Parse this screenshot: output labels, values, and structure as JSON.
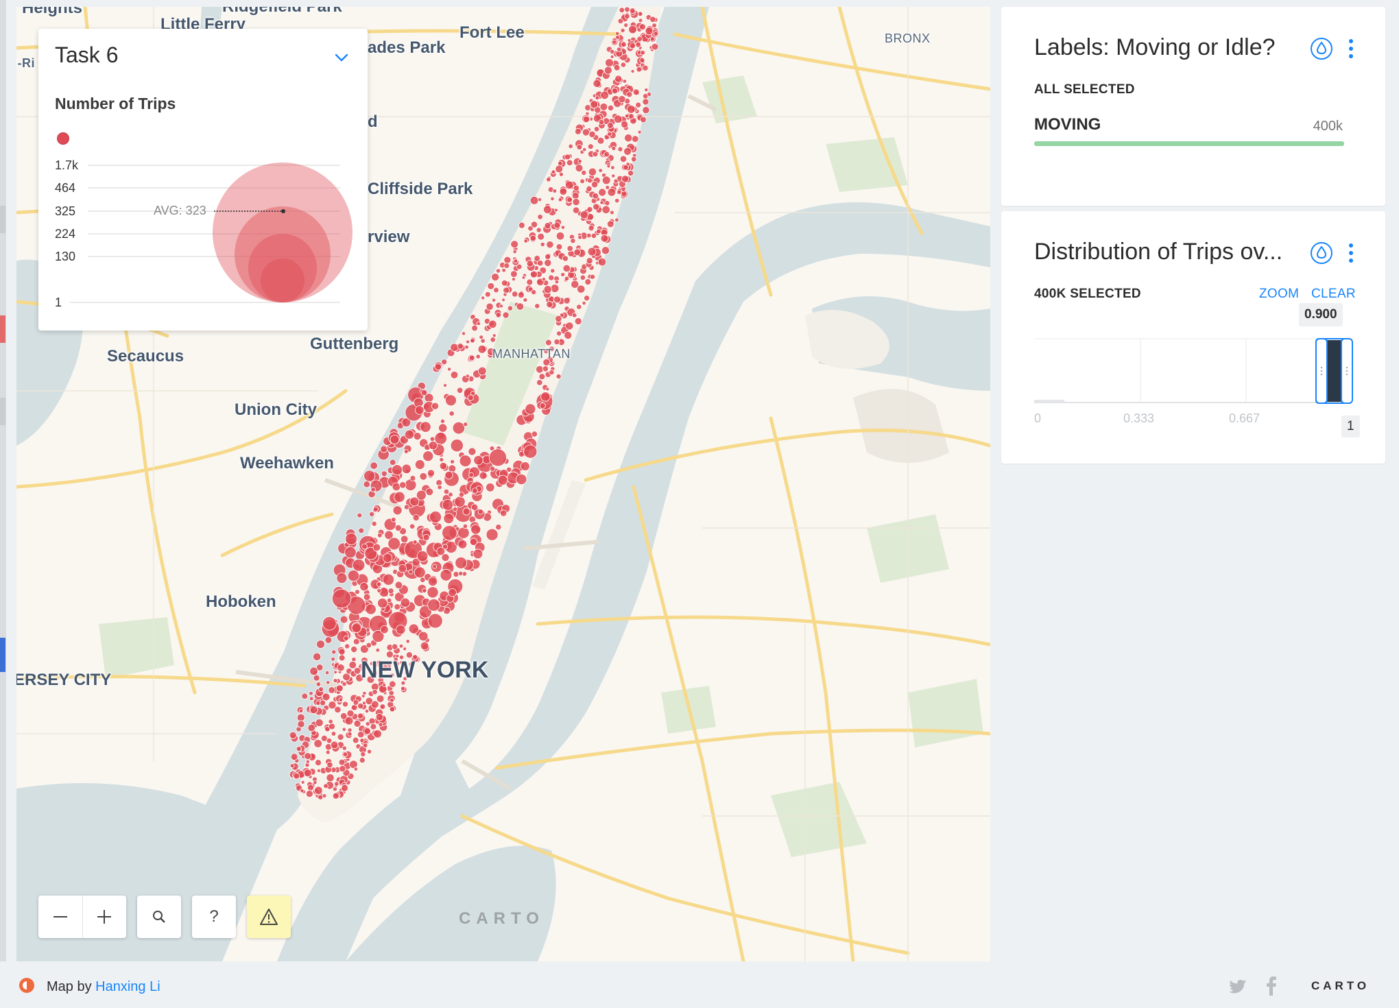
{
  "map": {
    "places": [
      {
        "name": "Heights"
      },
      {
        "name": "Little Ferry"
      },
      {
        "name": "Ridgefield Park"
      },
      {
        "name": "Fort Lee"
      },
      {
        "name": "BRONX"
      },
      {
        "name": "ades Park"
      },
      {
        "name": "d"
      },
      {
        "name": "Cliffside Park"
      },
      {
        "name": "rview"
      },
      {
        "name": "Guttenberg"
      },
      {
        "name": "Secaucus"
      },
      {
        "name": "MANHATTAN"
      },
      {
        "name": "Union City"
      },
      {
        "name": "Weehawken"
      },
      {
        "name": "Hoboken"
      },
      {
        "name": "NEW YORK"
      },
      {
        "name": "ERSEY CITY"
      },
      {
        "name": "l-Ri"
      }
    ],
    "watermark": "CARTO",
    "point_color": "#df4b55"
  },
  "legend": {
    "title": "Task 6",
    "subtitle": "Number of Trips",
    "ticks": [
      "1.7k",
      "464",
      "325",
      "224",
      "130",
      "1"
    ],
    "avg_label": "AVG: 323",
    "bubble_color": "#e0555d"
  },
  "controls": {
    "zoom_out_icon": "minus-icon",
    "zoom_in_icon": "plus-icon",
    "search_icon": "search-icon",
    "help_label": "?",
    "warning_icon": "warning-icon"
  },
  "widgets": {
    "category": {
      "title": "Labels: Moving or Idle?",
      "status": "ALL SELECTED",
      "items": [
        {
          "label": "MOVING",
          "count": "400k",
          "fraction": 1.0,
          "color": "#95d5a3"
        }
      ]
    },
    "histogram": {
      "title": "Distribution of Trips ov...",
      "status": "400K SELECTED",
      "zoom_label": "ZOOM",
      "clear_label": "CLEAR",
      "selection_label": "0.900",
      "axis_labels": [
        "0",
        "0.333",
        "0.667"
      ],
      "axis_end_label": "1",
      "selection_range": [
        0.9,
        1.0
      ]
    }
  },
  "footer": {
    "prefix": "Map by ",
    "author": "Hanxing Li",
    "brand": "CARTO"
  }
}
